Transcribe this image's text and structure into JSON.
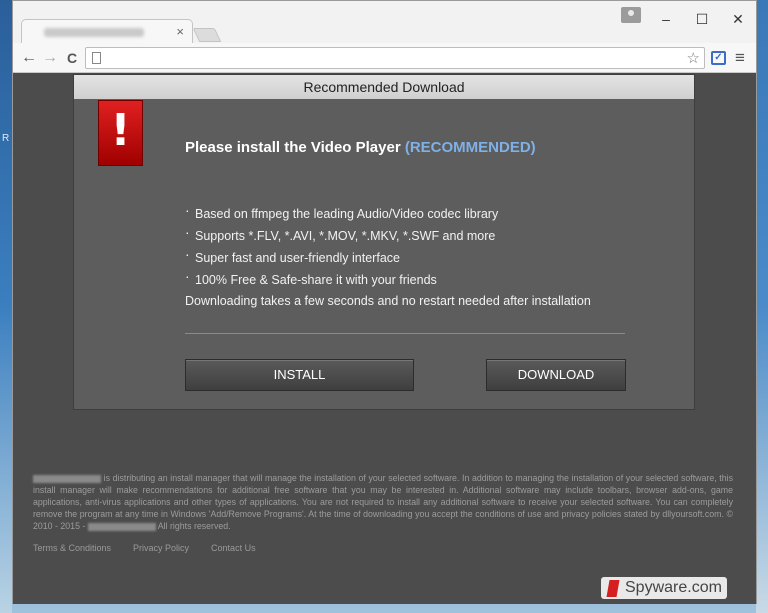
{
  "desktop": {
    "edge_letter": "R"
  },
  "browser": {
    "tab": {
      "close_glyph": "×"
    },
    "window_controls": {
      "minimize": "–",
      "maximize": "☐",
      "close": "✕"
    },
    "toolbar": {
      "back_glyph": "←",
      "forward_glyph": "→",
      "reload_glyph": "C",
      "address_value": "",
      "star_glyph": "☆",
      "menu_glyph": "≡",
      "ext_glyph": "✓"
    }
  },
  "dialog": {
    "title": "Recommended Download",
    "alert_glyph": "!",
    "headline": "Please install the Video Player",
    "headline_tag": "(RECOMMENDED)",
    "features": [
      "Based on ffmpeg the leading Audio/Video codec library",
      "Supports *.FLV, *.AVI, *.MOV, *.MKV, *.SWF and more",
      "Super fast and user-friendly interface",
      "100% Free & Safe-share it with your friends"
    ],
    "note": "Downloading takes a few seconds and no restart needed after installation",
    "install_label": "INSTALL",
    "download_label": "DOWNLOAD"
  },
  "legal": {
    "text_1": "is distributing an install manager that will manage the installation of your selected software. In addition to managing the installation of your selected software, this install manager will make recommendations for additional free software that you may be interested in. Additional software may include toolbars, browser add-ons, game applications, anti-virus applications and other types of applications. You are not required to install any additional software to receive your selected software. You can completely remove the program at any time in Windows 'Add/Remove Programs'. At the time of downloading you accept the conditions of use and privacy policies stated by dllyoursoft.com. © 2010 - 2015 -",
    "text_2": "All rights reserved."
  },
  "footer": {
    "terms": "Terms & Conditions",
    "privacy": "Privacy Policy",
    "contact": "Contact Us"
  },
  "watermark": {
    "text": "Spyware.com"
  }
}
